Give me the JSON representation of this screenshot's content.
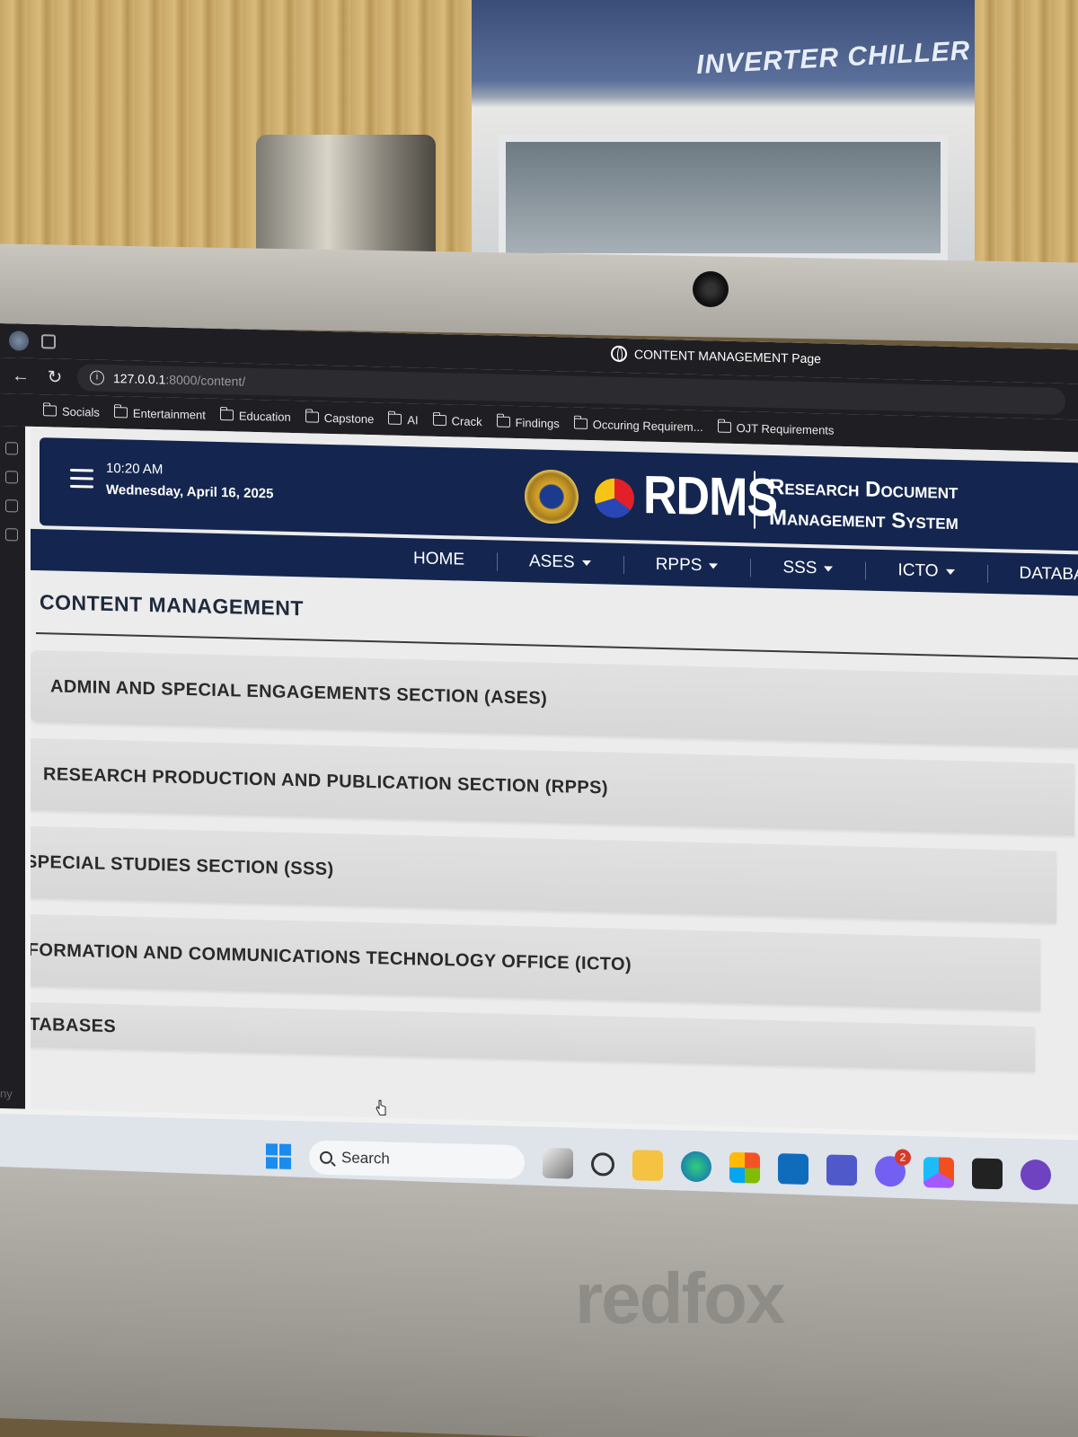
{
  "environment": {
    "appliance_label": "INVERTER CHILLER",
    "laptop_brand": "redfox"
  },
  "browser": {
    "tab_title": "CONTENT MANAGEMENT Page",
    "url_host": "127.0.0.1",
    "url_rest": ":8000/content/",
    "bookmarks": [
      "Socials",
      "Entertainment",
      "Education",
      "Capstone",
      "AI",
      "Crack",
      "Findings",
      "Occuring Requirem...",
      "OJT Requirements"
    ]
  },
  "header": {
    "time": "10:20 AM",
    "date": "Wednesday, April 16, 2025",
    "logo_text": "RDMS",
    "system_name_line1": "Research Document",
    "system_name_line2": "Management System"
  },
  "nav": {
    "items": [
      {
        "label": "HOME",
        "dropdown": false
      },
      {
        "label": "ASES",
        "dropdown": true
      },
      {
        "label": "RPPS",
        "dropdown": true
      },
      {
        "label": "SSS",
        "dropdown": true
      },
      {
        "label": "ICTO",
        "dropdown": true
      },
      {
        "label": "DATABAS",
        "dropdown": false
      }
    ]
  },
  "main": {
    "page_title": "CONTENT MANAGEMENT",
    "sections": [
      "ADMIN AND SPECIAL ENGAGEMENTS SECTION (ASES)",
      "RESEARCH PRODUCTION AND PUBLICATION SECTION (RPPS)",
      "SPECIAL STUDIES SECTION (SSS)",
      "INFORMATION AND COMMUNICATIONS TECHNOLOGY OFFICE (ICTO)",
      "DATABASES"
    ]
  },
  "sidebar_status": "ny",
  "taskbar": {
    "search_placeholder": "Search",
    "notification_count": "2"
  },
  "colors": {
    "header_bg": "#14264f",
    "browser_chrome": "#1f1f23",
    "card_bg": "#dcdcdc",
    "taskbar_bg": "#dfe3ea"
  }
}
